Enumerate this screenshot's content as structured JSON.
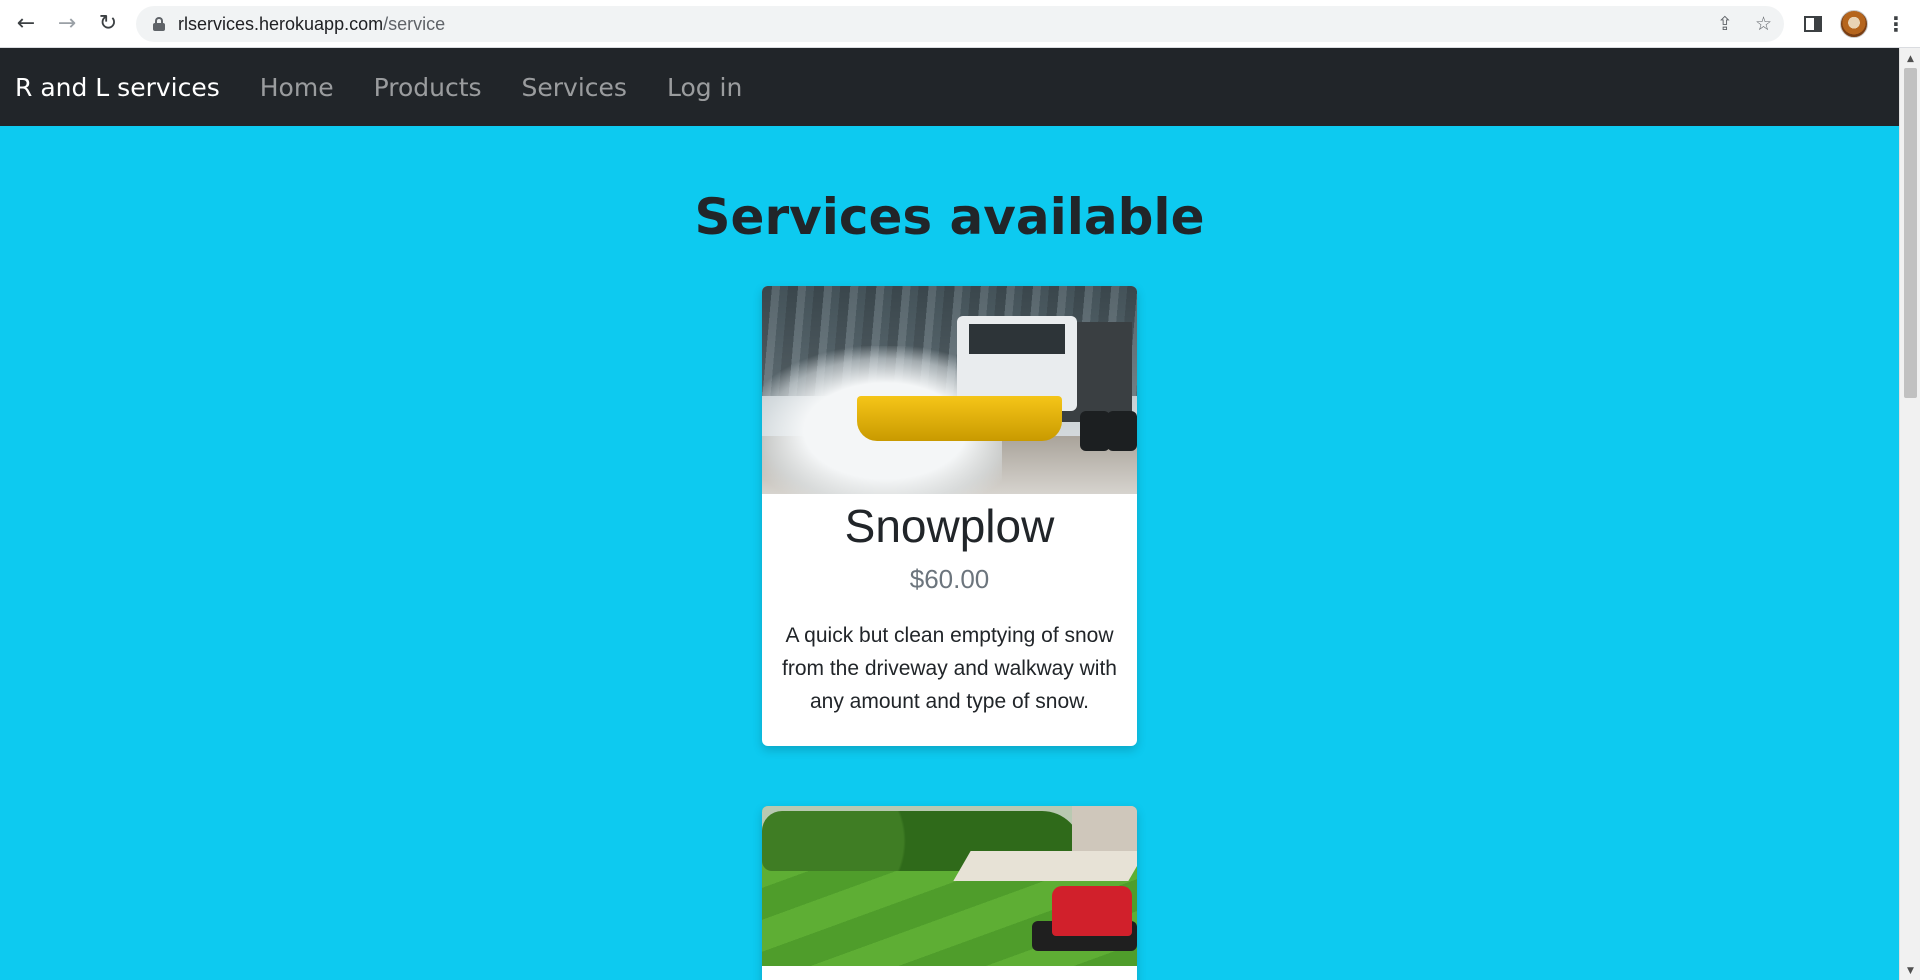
{
  "browser": {
    "url_host": "rlservices.herokuapp.com",
    "url_path": "/service",
    "back_icon": "←",
    "forward_icon": "→",
    "reload_icon": "↻",
    "share_icon": "⇪",
    "star_icon": "☆",
    "menu_icon": "⋮"
  },
  "navbar": {
    "brand": "R and L services",
    "links": [
      "Home",
      "Products",
      "Services",
      "Log in"
    ],
    "background": "#212529"
  },
  "main": {
    "background": "#0dcaf0",
    "title": "Services available",
    "cards": [
      {
        "image": "snowplow-truck-image",
        "title": "Snowplow",
        "price": "$60.00",
        "description": "A quick but clean emptying of snow from the driveway and walkway with any amount and type of snow."
      },
      {
        "image": "lawn-mower-image"
      }
    ]
  },
  "scrollbar": {
    "up_icon": "▲",
    "down_icon": "▼"
  }
}
